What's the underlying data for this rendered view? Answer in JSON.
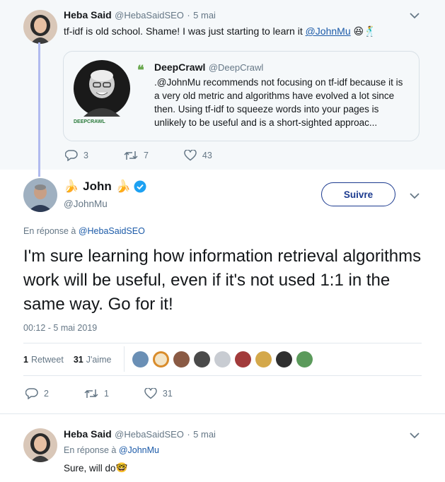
{
  "parent_tweet": {
    "author_name": "Heba Said",
    "author_handle": "@HebaSaidSEO",
    "separator": "·",
    "date": "5 mai",
    "text_before_mention": "tf-idf is old school. Shame! I was just starting to learn it ",
    "mention": "@JohnMu",
    "emojis": "😆🕺",
    "quote": {
      "author_name": "DeepCrawl",
      "author_handle": "@DeepCrawl",
      "brand_label": "DEEPCRAWL",
      "text": ".@JohnMu recommends not focusing on tf-idf because it is a very old metric and algorithms have evolved a lot since then. Using tf-idf to squeeze words into your pages is unlikely to be useful and is a short-sighted approac..."
    },
    "actions": {
      "replies": "3",
      "retweets": "7",
      "likes": "43"
    }
  },
  "main_tweet": {
    "author_name": "John",
    "author_handle": "@JohnMu",
    "follow_label": "Suivre",
    "reply_prefix": "En réponse à ",
    "reply_to": "@HebaSaidSEO",
    "text": "I'm sure learning how information retrieval algorithms work will be useful, even if it's not used 1:1 in the same way. Go for it!",
    "timestamp": "00:12 - 5 mai 2019",
    "stats": {
      "retweets_count": "1",
      "retweets_label": "Retweet",
      "likes_count": "31",
      "likes_label": "J'aime"
    },
    "actions": {
      "replies": "2",
      "retweets": "1",
      "likes": "31"
    }
  },
  "reply_tweet": {
    "author_name": "Heba Said",
    "author_handle": "@HebaSaidSEO",
    "separator": "·",
    "date": "5 mai",
    "reply_prefix": "En réponse à ",
    "reply_to": "@JohnMu",
    "text": "Sure, will do",
    "emoji": "🤓"
  },
  "colors": {
    "accent_blue": "#1da1f2",
    "link": "#1b5aa8",
    "thread_line": "#b1bbef",
    "muted": "#657786"
  }
}
